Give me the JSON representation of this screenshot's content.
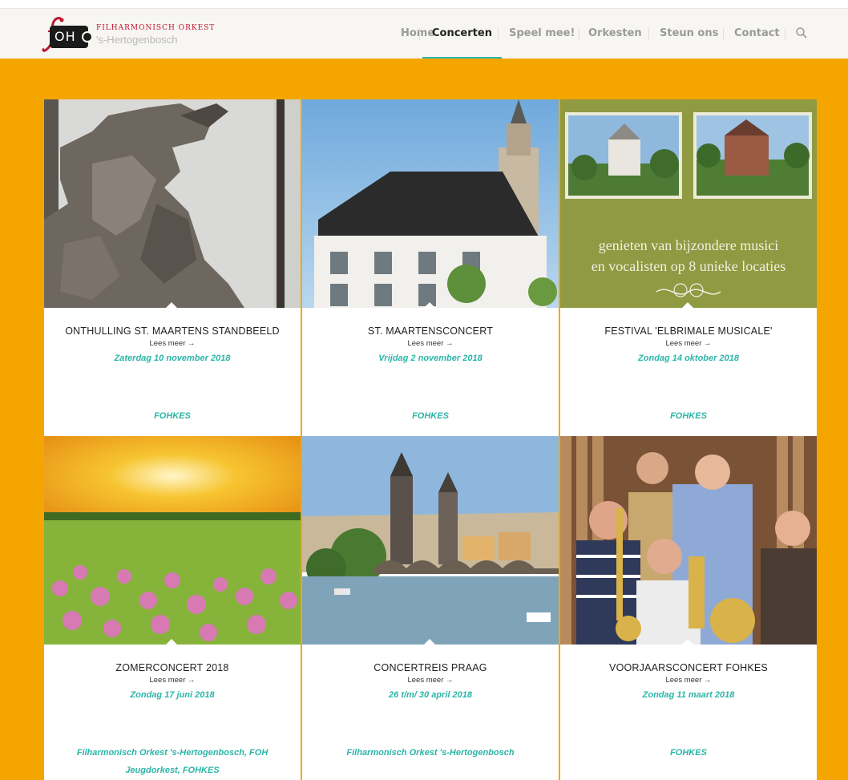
{
  "header": {
    "logo_text": "OH",
    "logo_line1": "FILHARMONISCH ORKEST",
    "logo_line2": "'s-Hertogenbosch",
    "nav": [
      {
        "label": "Home",
        "active": false
      },
      {
        "label": "Concerten",
        "active": true
      },
      {
        "label": "Speel mee!",
        "active": false
      },
      {
        "label": "Orkesten",
        "active": false
      },
      {
        "label": "Steun ons",
        "active": false
      },
      {
        "label": "Contact",
        "active": false
      }
    ],
    "search_icon": "search-icon"
  },
  "cards": [
    {
      "title": "ONTHULLING ST. MAARTENS STANDBEELD",
      "more": "Lees meer →",
      "date": "Zaterdag 10 november 2018",
      "tags": "FOHKES",
      "image": "bronze-statue"
    },
    {
      "title": "ST. MAARTENSCONCERT",
      "more": "Lees meer →",
      "date": "Vrijdag 2 november 2018",
      "tags": "FOHKES",
      "image": "church-tower"
    },
    {
      "title": "FESTIVAL 'ELBRIMALE MUSICALE'",
      "more": "Lees meer →",
      "date": "Zondag 14 oktober 2018",
      "tags": "FOHKES",
      "image": "festival-poster",
      "image_text_1": "genieten van bijzondere musici",
      "image_text_2": "en vocalisten op 8 unieke locaties"
    },
    {
      "title": "ZOMERCONCERT 2018",
      "more": "Lees meer →",
      "date": "Zondag 17 juni 2018",
      "tags": "Filharmonisch Orkest 's-Hertogenbosch, FOH Jeugdorkest, FOHKES",
      "image": "flower-field"
    },
    {
      "title": "CONCERTREIS PRAAG",
      "more": "Lees meer →",
      "date": "26 t/m/ 30 april 2018",
      "tags": "Filharmonisch Orkest 's-Hertogenbosch",
      "image": "prague-river"
    },
    {
      "title": "VOORJAARSCONCERT FOHKES",
      "more": "Lees meer →",
      "date": "Zondag 11 maart 2018",
      "tags": "FOHKES",
      "image": "brass-players"
    }
  ],
  "colors": {
    "accent": "#2bb5a8",
    "background": "#f5a500",
    "logo_red": "#c0152c"
  }
}
